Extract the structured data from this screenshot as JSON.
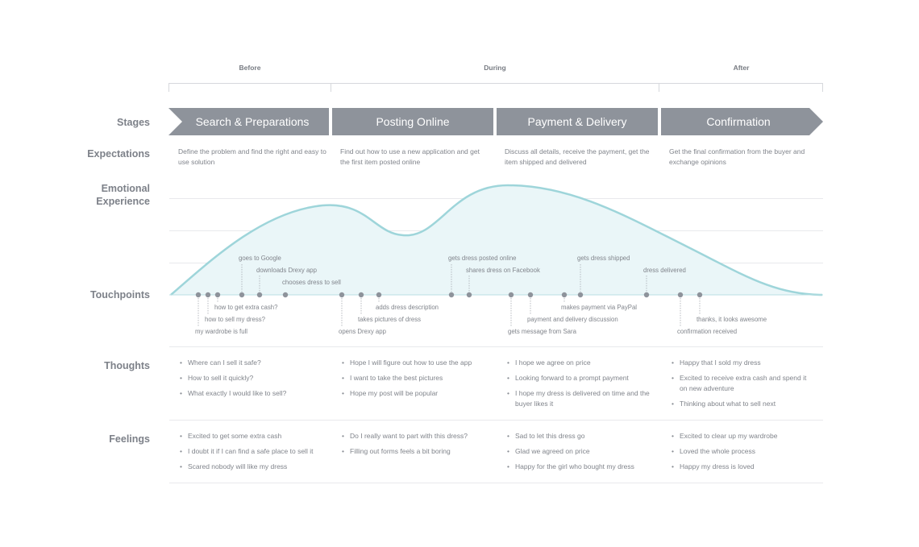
{
  "phases": [
    {
      "label": "Before"
    },
    {
      "label": "During"
    },
    {
      "label": "After"
    }
  ],
  "rows": {
    "stages": "Stages",
    "expectations": "Expectations",
    "emotional": "Emotional Experience",
    "touchpoints": "Touchpoints",
    "thoughts": "Thoughts",
    "feelings": "Feelings"
  },
  "stages": [
    {
      "label": "Search & Preparations"
    },
    {
      "label": "Posting Online"
    },
    {
      "label": "Payment & Delivery"
    },
    {
      "label": "Confirmation"
    }
  ],
  "expectations": [
    "Define the problem and find the right and easy to use solution",
    "Find out how to use a new application and get the first item posted online",
    "Discuss all details, receive the payment, get the item shipped and delivered",
    "Get the final confirmation from the buyer and exchange opinions"
  ],
  "touchpoints_above": [
    "goes to Google",
    "downloads Drexy app",
    "chooses dress to sell",
    "gets dress posted online",
    "shares dress on Facebook",
    "gets dress shipped",
    "dress delivered"
  ],
  "touchpoints_below": [
    "how to get extra cash?",
    "how to sell my dress?",
    "my wardrobe is full",
    "adds dress description",
    "takes pictures of dress",
    "opens Drexy app",
    "makes payment via PayPal",
    "payment and delivery discussion",
    "gets message from Sara",
    "thanks, it looks awesome",
    "confirmation received"
  ],
  "thoughts": [
    [
      "Where can I sell it safe?",
      "How to sell it quickly?",
      "What exactly I would like to sell?"
    ],
    [
      "Hope I will figure out how to use the app",
      "I want to take the best pictures",
      "Hope my post will be popular"
    ],
    [
      "I hope we agree on price",
      "Looking forward to a prompt payment",
      "I hope my dress is delivered on time and the buyer likes it"
    ],
    [
      "Happy that I sold my dress",
      "Excited to receive extra cash and spend it on new adventure",
      "Thinking about what to sell next"
    ]
  ],
  "feelings": [
    [
      "Excited to get some extra cash",
      "I doubt it if I can find a safe place to sell it",
      "Scared nobody will like my dress"
    ],
    [
      "Do I really want to part with this dress?",
      "Filling out forms feels a bit boring"
    ],
    [
      "Sad to let this dress go",
      "Glad we agreed on price",
      "Happy for the girl who bought my dress"
    ],
    [
      "Excited to clear up my wardrobe",
      "Loved the whole process",
      "Happy my dress is loved"
    ]
  ],
  "colors": {
    "stage_fill": "#8e939b",
    "curve_stroke": "#9ed5da",
    "curve_fill": "#eaf6f8",
    "dot": "#8e939b"
  }
}
